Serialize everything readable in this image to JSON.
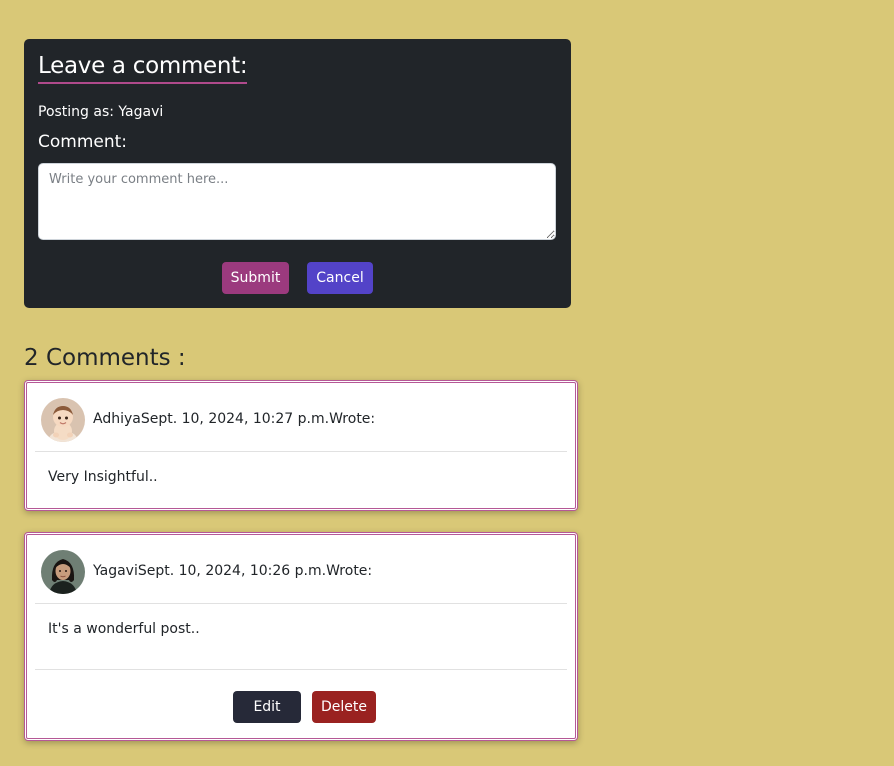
{
  "form": {
    "title": "Leave a comment:",
    "posting_as": "Posting as: Yagavi",
    "comment_label": "Comment:",
    "comment_placeholder": "Write your comment here...",
    "comment_value": "",
    "submit_label": "Submit",
    "cancel_label": "Cancel",
    "colors": {
      "panel": "#212529",
      "title_underline": "#b04a8c",
      "submit": "#9b3a7e",
      "cancel": "#5343c8"
    }
  },
  "comments": {
    "heading": "2 Comments :",
    "items": [
      {
        "author": "Adhiya",
        "date": "Sept. 10, 2024, 10:27 p.m.",
        "suffix": "Wrote:",
        "meta": "AdhiyaSept. 10, 2024, 10:27 p.m.Wrote:",
        "body": "Very Insightful..",
        "avatar_icon": "baby-avatar"
      },
      {
        "author": "Yagavi",
        "date": "Sept. 10, 2024, 10:26 p.m.",
        "suffix": "Wrote:",
        "meta": "YagaviSept. 10, 2024, 10:26 p.m.Wrote:",
        "body": "It's a wonderful post..",
        "avatar_icon": "woman-avatar",
        "edit_label": "Edit",
        "delete_label": "Delete"
      }
    ],
    "colors": {
      "card_border": "#b55896",
      "edit": "#262938",
      "delete": "#9a2220"
    }
  },
  "page": {
    "background": "#d9c877"
  }
}
